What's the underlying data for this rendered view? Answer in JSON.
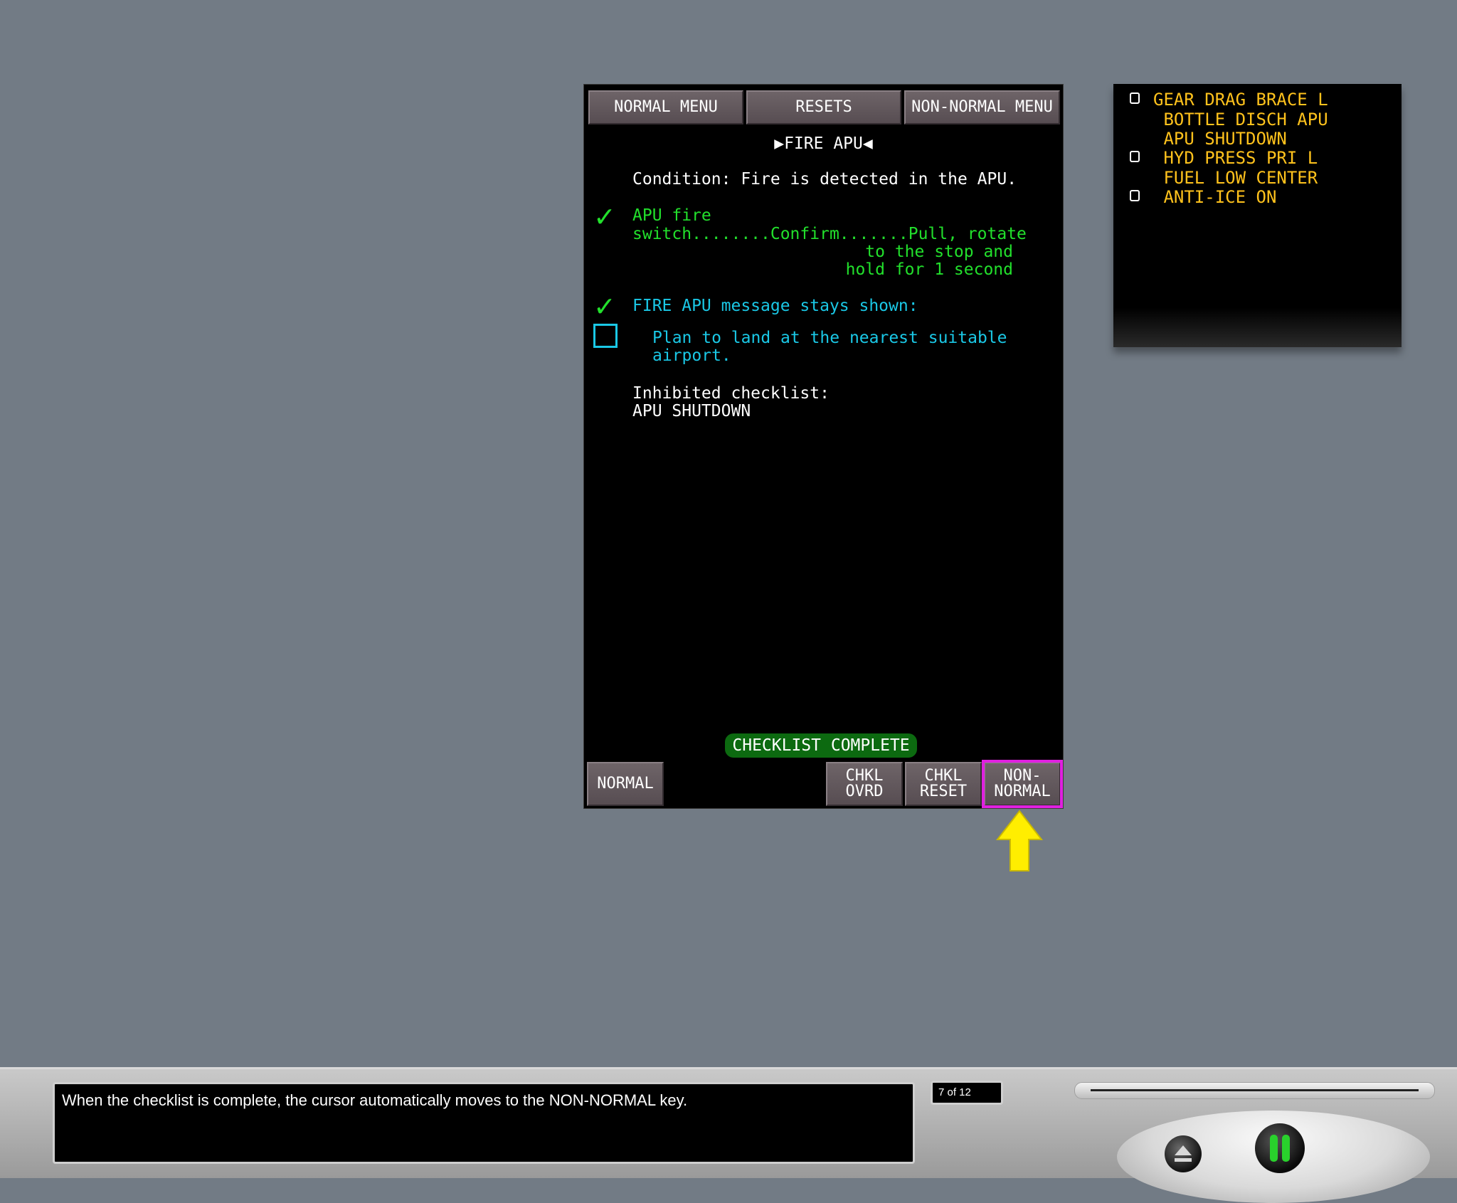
{
  "top_menu": {
    "normal_menu": "NORMAL MENU",
    "resets": "RESETS",
    "non_normal_menu": "NON-NORMAL MENU"
  },
  "checklist": {
    "title": "▶FIRE APU◀",
    "condition": "Condition: Fire is detected in the APU.",
    "step1_line1": "APU fire",
    "step1_line2": "switch........Confirm.......Pull, rotate",
    "step1_line3": "to the stop and",
    "step1_line4": "hold for 1 second",
    "step2": "FIRE APU message stays shown:",
    "step3_line1": "Plan to land at the nearest suitable",
    "step3_line2": "airport.",
    "inhibited_label": "Inhibited checklist:",
    "inhibited_item": "APU SHUTDOWN",
    "complete_label": "CHECKLIST COMPLETE"
  },
  "bottom_keys": {
    "normal": "NORMAL",
    "chkl_ovrd": "CHKL\nOVRD",
    "chkl_reset": "CHKL\nRESET",
    "non_normal": "NON-\nNORMAL"
  },
  "messages": [
    {
      "text": "GEAR DRAG BRACE L",
      "checkbox": true
    },
    {
      "text": " BOTTLE DISCH APU",
      "checkbox": false
    },
    {
      "text": " APU SHUTDOWN",
      "checkbox": false
    },
    {
      "text": " HYD PRESS PRI L",
      "checkbox": true
    },
    {
      "text": " FUEL LOW CENTER",
      "checkbox": false
    },
    {
      "text": " ANTI-ICE ON",
      "checkbox": true
    }
  ],
  "player": {
    "caption": "When the checklist is complete, the cursor automatically moves to the NON-NORMAL key.",
    "page_counter": "7 of 12",
    "progress_fraction": 0.58
  },
  "colors": {
    "screen_bg": "#727b85",
    "checked_green": "#22e02c",
    "pending_cyan": "#1ac8e6",
    "message_amber": "#ffc21c",
    "cursor_magenta": "#e020e0",
    "arrow_yellow": "#ffee00"
  },
  "icons": {
    "step_done": "check-mark-icon",
    "step_open": "empty-checkbox-icon",
    "arrow": "arrow-up-icon",
    "eject": "eject-icon",
    "pause": "pause-icon"
  }
}
